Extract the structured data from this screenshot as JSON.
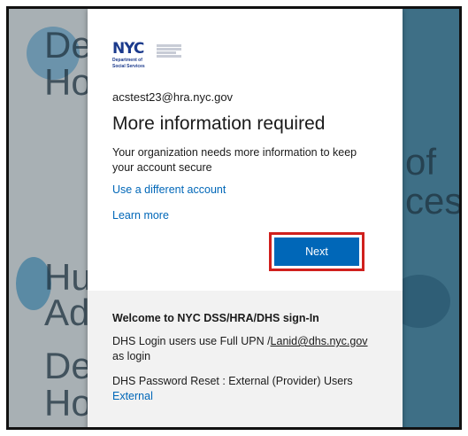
{
  "background": {
    "left_words": [
      "De",
      "Ho",
      "Hu",
      "Ad",
      "De",
      "Ho"
    ],
    "right_words": [
      "of",
      "ces"
    ]
  },
  "logo": {
    "mark": "NYC",
    "dept_line1": "Department of",
    "dept_line2": "Social Services"
  },
  "signin": {
    "email": "acstest23@hra.nyc.gov",
    "title": "More information required",
    "description": "Your organization needs more information to keep your account secure",
    "use_different_account": "Use a different account",
    "learn_more": "Learn more",
    "next_label": "Next"
  },
  "footer": {
    "welcome": "Welcome to NYC DSS/HRA/DHS sign-In",
    "login_prefix": "DHS Login users use Full UPN /",
    "login_example": "Lanid@dhs.nyc.gov",
    "login_suffix": "as login",
    "reset_text": "DHS Password Reset : External (Provider) Users",
    "external_link": "External"
  },
  "colors": {
    "primary": "#0067b8",
    "highlight": "#d0201d",
    "nyc_blue": "#1b3a8c"
  }
}
